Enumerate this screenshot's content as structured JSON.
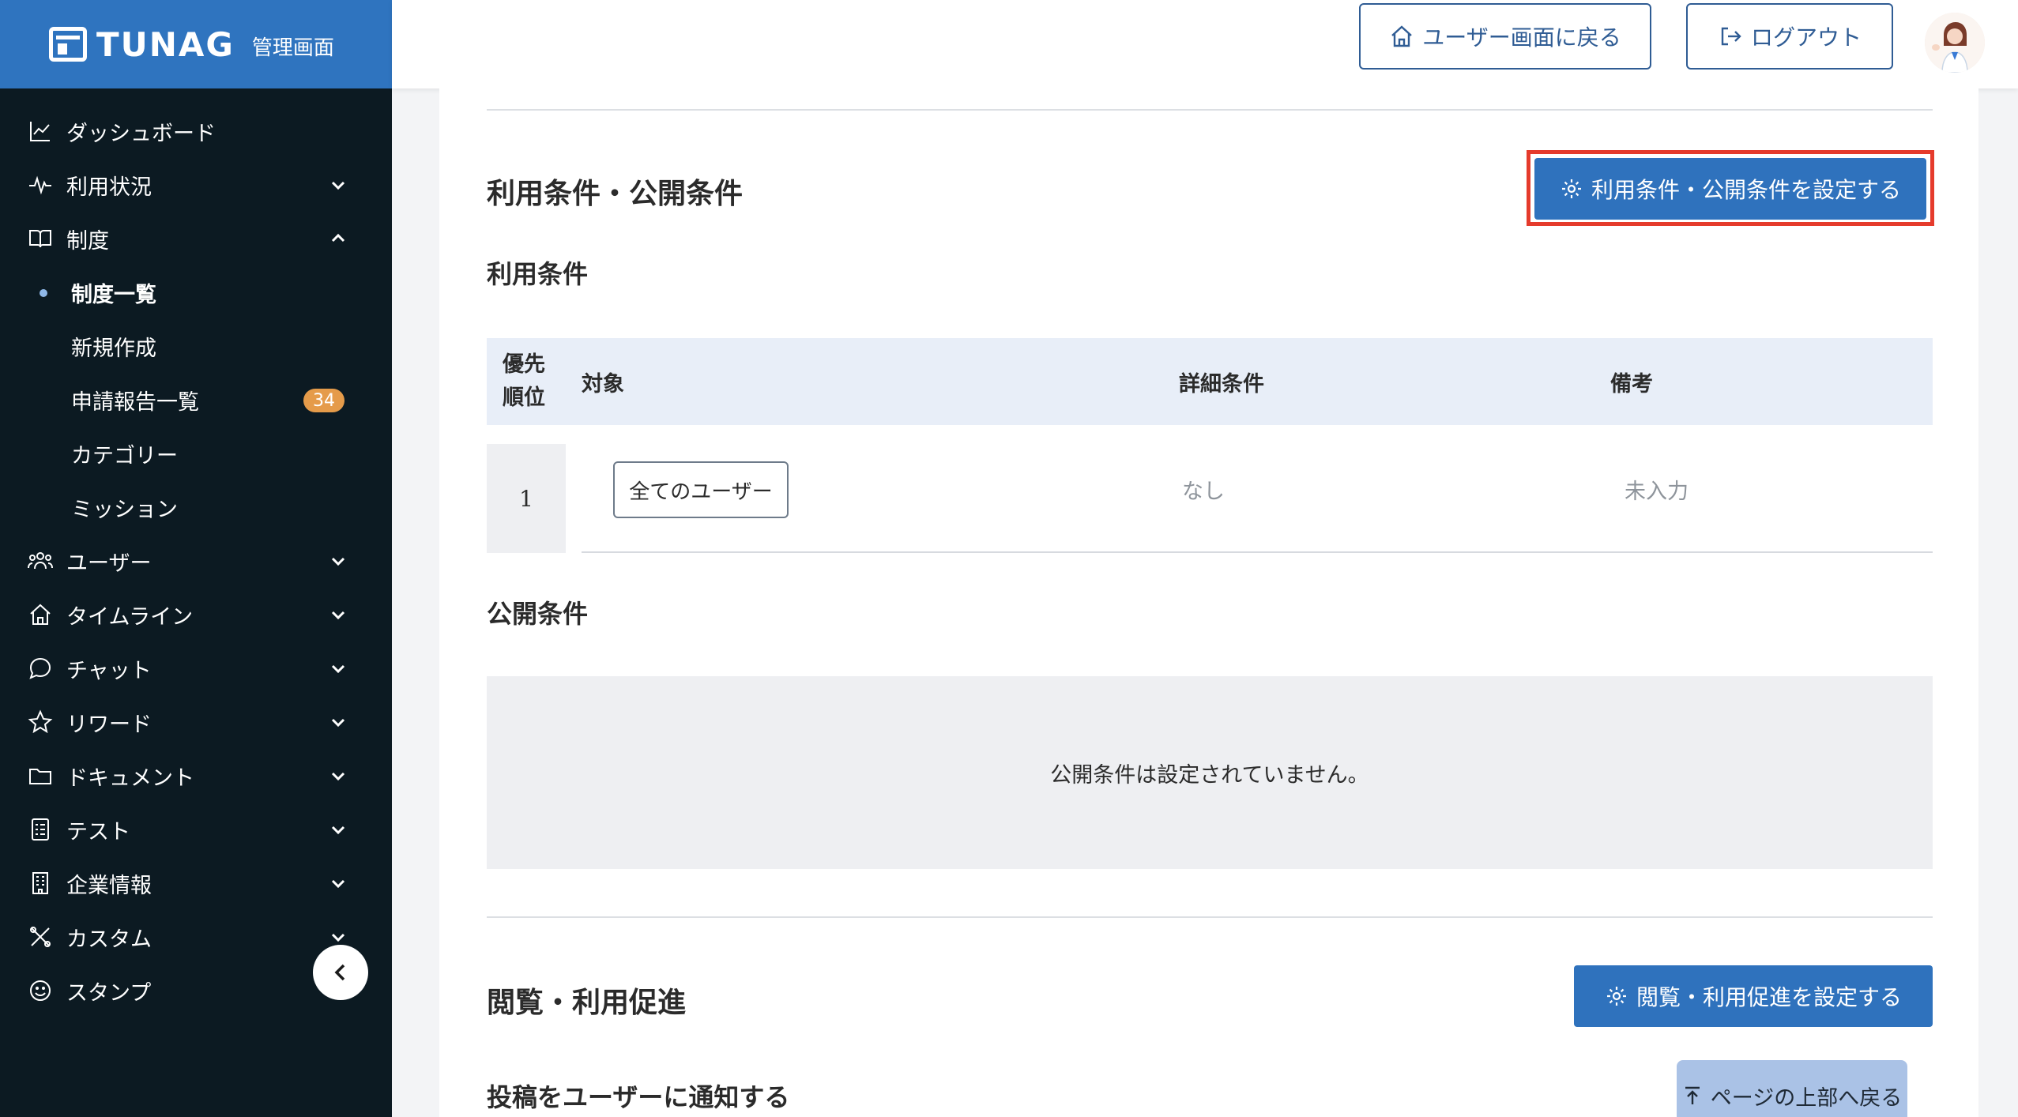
{
  "brand": {
    "name": "TUNAG",
    "subtitle": "管理画面"
  },
  "sidebar": {
    "items": [
      {
        "label": "ダッシュボード",
        "icon": "chart-line-icon"
      },
      {
        "label": "利用状況",
        "icon": "activity-icon"
      },
      {
        "label": "制度",
        "icon": "book-icon"
      },
      {
        "label": "ユーザー",
        "icon": "users-icon"
      },
      {
        "label": "タイムライン",
        "icon": "home-icon"
      },
      {
        "label": "チャット",
        "icon": "chat-icon"
      },
      {
        "label": "リワード",
        "icon": "star-icon"
      },
      {
        "label": "ドキュメント",
        "icon": "folder-icon"
      },
      {
        "label": "テスト",
        "icon": "test-list-icon"
      },
      {
        "label": "企業情報",
        "icon": "building-icon"
      },
      {
        "label": "カスタム",
        "icon": "tools-icon"
      },
      {
        "label": "スタンプ",
        "icon": "smile-icon"
      }
    ],
    "sub_items": [
      {
        "label": "制度一覧"
      },
      {
        "label": "新規作成"
      },
      {
        "label": "申請報告一覧",
        "badge": "34"
      },
      {
        "label": "カテゴリー"
      },
      {
        "label": "ミッション"
      }
    ]
  },
  "header": {
    "back_to_user_label": "ユーザー画面に戻る",
    "logout_label": "ログアウト"
  },
  "section1": {
    "title": "利用条件・公開条件",
    "button_label": "利用条件・公開条件を設定する",
    "usage_title": "利用条件",
    "table": {
      "headers": {
        "priority": "優先順位",
        "priority_line1": "優先",
        "priority_line2": "順位",
        "target": "対象",
        "detail": "詳細条件",
        "note": "備考"
      },
      "rows": [
        {
          "priority": "1",
          "target": "全てのユーザー",
          "detail": "なし",
          "note": "未入力"
        }
      ]
    },
    "public_title": "公開条件",
    "public_empty": "公開条件は設定されていません。"
  },
  "section2": {
    "title": "閲覧・利用促進",
    "button_label": "閲覧・利用促進を設定する",
    "notify_title": "投稿をユーザーに通知する"
  },
  "scroll_top_label": "ページの上部へ戻る",
  "colors": {
    "brand": "#2f74bf",
    "sidebar_bg": "#0c1a22",
    "primary": "#2f72bd",
    "highlight": "#e53b2c",
    "badge": "#e59b4a"
  }
}
